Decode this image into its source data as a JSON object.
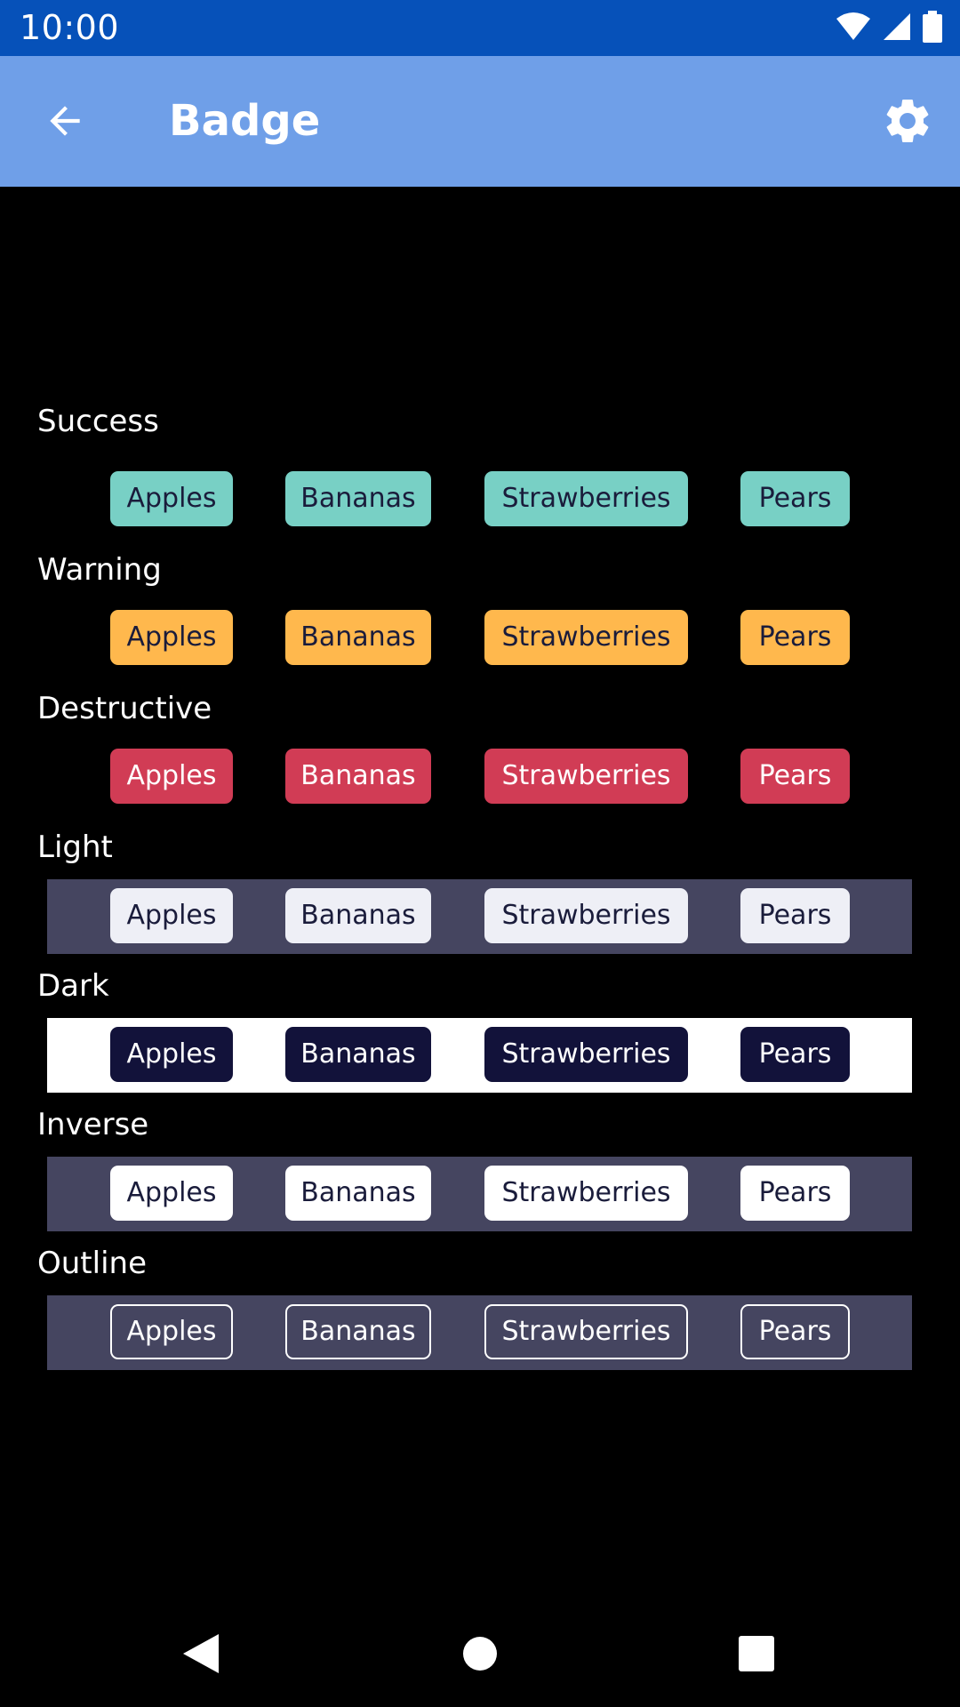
{
  "status_bar": {
    "time": "10:00",
    "icons": [
      "wifi-icon",
      "cell-signal-icon",
      "battery-icon"
    ]
  },
  "app_bar": {
    "title": "Badge",
    "back_icon": "arrow-left-icon",
    "settings_icon": "gear-icon"
  },
  "sections": [
    {
      "label": "Success",
      "variant": "success",
      "badges": [
        "Apples",
        "Bananas",
        "Strawberries",
        "Pears"
      ],
      "colors": {
        "bg": "#78d0c5",
        "text": "#1a1c3b"
      }
    },
    {
      "label": "Warning",
      "variant": "warning",
      "badges": [
        "Apples",
        "Bananas",
        "Strawberries",
        "Pears"
      ],
      "colors": {
        "bg": "#ffb84d",
        "text": "#1a1c3b"
      }
    },
    {
      "label": "Destructive",
      "variant": "destructive",
      "badges": [
        "Apples",
        "Bananas",
        "Strawberries",
        "Pears"
      ],
      "colors": {
        "bg": "#d13c55",
        "text": "#ffffff"
      }
    },
    {
      "label": "Light",
      "variant": "light",
      "badges": [
        "Apples",
        "Bananas",
        "Strawberries",
        "Pears"
      ],
      "colors": {
        "bg": "#eeeff6",
        "text": "#1a1c3b",
        "row_bg": "#454560"
      }
    },
    {
      "label": "Dark",
      "variant": "dark",
      "badges": [
        "Apples",
        "Bananas",
        "Strawberries",
        "Pears"
      ],
      "colors": {
        "bg": "#12123a",
        "text": "#ffffff",
        "row_bg": "#ffffff"
      }
    },
    {
      "label": "Inverse",
      "variant": "inverse",
      "badges": [
        "Apples",
        "Bananas",
        "Strawberries",
        "Pears"
      ],
      "colors": {
        "bg": "#ffffff",
        "text": "#1a1c3b",
        "row_bg": "#454560"
      }
    },
    {
      "label": "Outline",
      "variant": "outline",
      "badges": [
        "Apples",
        "Bananas",
        "Strawberries",
        "Pears"
      ],
      "colors": {
        "border": "#ffffff",
        "text": "#ffffff",
        "row_bg": "#454560"
      }
    }
  ],
  "nav_bar": {
    "back": "nav-back-icon",
    "home": "nav-home-icon",
    "recents": "nav-recents-icon"
  },
  "theme": {
    "status_bar": "#0651b9",
    "app_bar": "#6f9fe8",
    "background": "#000000"
  }
}
